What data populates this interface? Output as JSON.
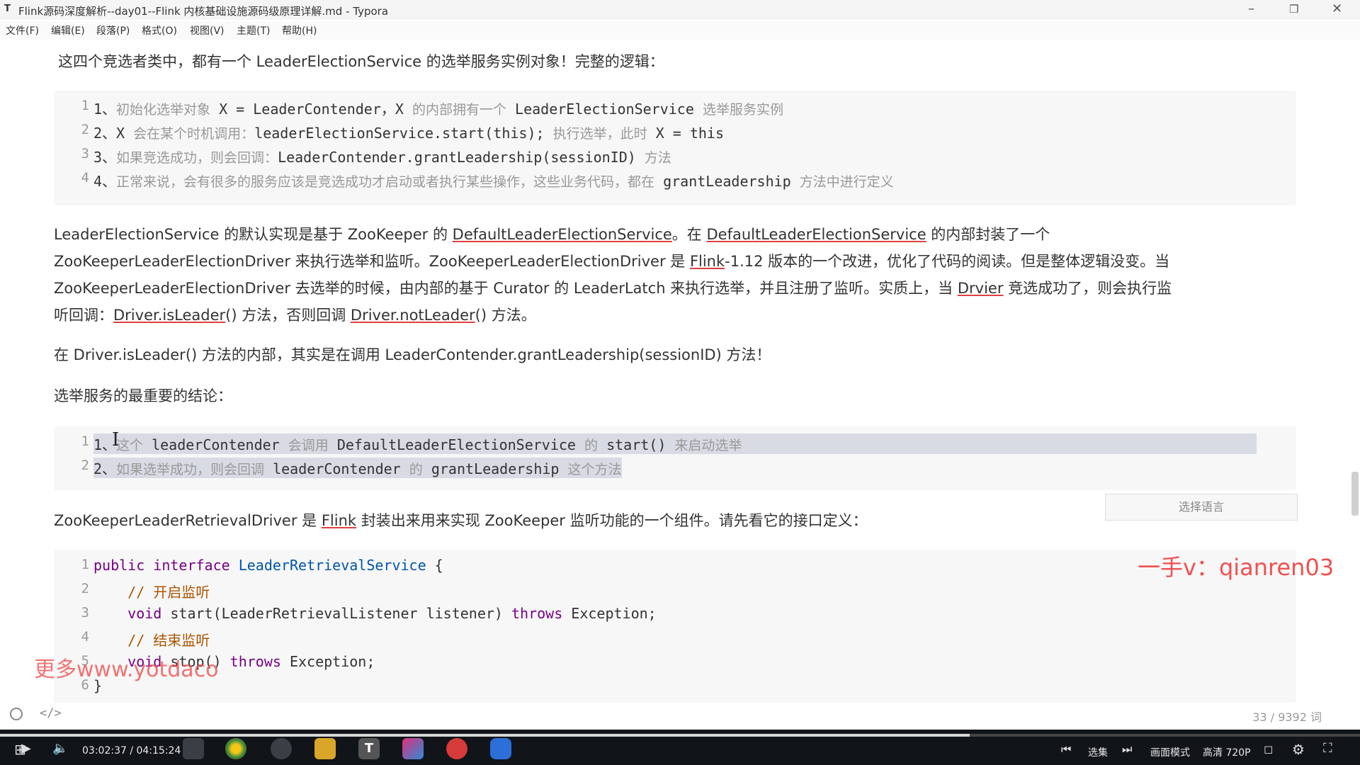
{
  "window": {
    "title": "Flink源码深度解析--day01--Flink 内核基础设施源码级原理详解.md - Typora",
    "app_icon": "T"
  },
  "menu": [
    "文件(F)",
    "编辑(E)",
    "段落(P)",
    "格式(O)",
    "视图(V)",
    "主题(T)",
    "帮助(H)"
  ],
  "doc": {
    "intro": "这四个竞选者类中，都有一个 LeaderElectionService 的选举服务实例对象！完整的逻辑：",
    "block1": [
      {
        "n": "1",
        "pre": "1、",
        "cn1": "初始化选举对象",
        "c1": " X = LeaderContender，X ",
        "cn2": "的内部拥有一个",
        "c2": " LeaderElectionService ",
        "cn3": "选举服务实例"
      },
      {
        "n": "2",
        "pre": "2、",
        "c0": "X ",
        "cn1": "会在某个时机调用：",
        "c1": "leaderElectionService.start(this); ",
        "cn2": "执行选举，此时",
        "c2": " X = this"
      },
      {
        "n": "3",
        "pre": "3、",
        "cn1": "如果竞选成功，则会回调：",
        "c1": "LeaderContender.grantLeadership(sessionID) ",
        "cn2": "方法"
      },
      {
        "n": "4",
        "pre": "4、",
        "cn1": "正常来说，会有很多的服务应该是竞选成功才启动或者执行某些操作，这些业务代码，都在",
        "c1": " grantLeadership ",
        "cn2": "方法中进行定义"
      }
    ],
    "p2": {
      "l1a": "LeaderElectionService 的默认实现是基于 ZooKeeper 的 ",
      "l1b": "DefaultLeaderElectionService",
      "l1c": "。在 ",
      "l1d": "DefaultLeaderElectionService",
      "l1e": " 的内部封装了一个",
      "l2a": "ZooKeeperLeaderElectionDriver 来执行选举和监听。ZooKeeperLeaderElectionDriver 是 ",
      "l2b": "Flink",
      "l2c": "-1.12 版本的一个改进，优化了代码的阅读。但是整体逻辑没变。当",
      "l3a": "ZooKeeperLeaderElectionDriver 去选举的时候，由内部的基于 Curator 的 LeaderLatch 来执行选举，并且注册了监听。实质上，当 ",
      "l3b": "Drvier",
      "l3c": " 竞选成功了，则会执行监",
      "l4a": "听回调：",
      "l4b": "Driver.isLeader",
      "l4c": "() 方法，否则回调 ",
      "l4d": "Driver.notLeader",
      "l4e": "() 方法。"
    },
    "p3": "在 Driver.isLeader() 方法的内部，其实是在调用 LeaderContender.grantLeadership(sessionID) 方法！",
    "p4": "选举服务的最重要的结论：",
    "block2": [
      {
        "n": "1",
        "pre": "1、",
        "cn1": "这个",
        "c1": " leaderContender ",
        "cn2": "会调用",
        "c2": " DefaultLeaderElectionService ",
        "cn3": "的",
        "c3": " start() ",
        "cn4": "来启动选举"
      },
      {
        "n": "2",
        "pre": "2、",
        "cn1": "如果选举成功，则会回调",
        "c1": " leaderContender ",
        "cn2": "的",
        "c2": " grantLeadership ",
        "cn3": "这个方法"
      }
    ],
    "lang_select": "选择语言",
    "p5a": "ZooKeeperLeaderRetrievalDriver 是 ",
    "p5b": "Flink",
    "p5c": " 封装出来用来实现 ZooKeeper 监听功能的一个组件。请先看它的接口定义：",
    "block3": {
      "l1_kw1": "public",
      "l1_kw2": " interface ",
      "l1_def": "LeaderRetrievalService",
      "l1_rest": " {",
      "l2": "    // 开启监听",
      "l3_kw": "    void",
      "l3_mid": " start(LeaderRetrievalListener listener) ",
      "l3_kw2": "throws",
      "l3_end": " Exception;",
      "l4": "    // 结束监听",
      "l5_kw": "    void",
      "l5_mid": " stop() ",
      "l5_kw2": "throws",
      "l5_end": " Exception;",
      "l6": "}"
    },
    "watermark_right": "一手v：qianren03",
    "watermark_left": "更多www.yotdaco",
    "word_count": "33 / 9392 词"
  },
  "player": {
    "time": "03:02:37 / 04:15:24",
    "progress": 0.713,
    "select_episode": "选集",
    "picture_mode": "画面模式",
    "quality": "高清 720P"
  }
}
